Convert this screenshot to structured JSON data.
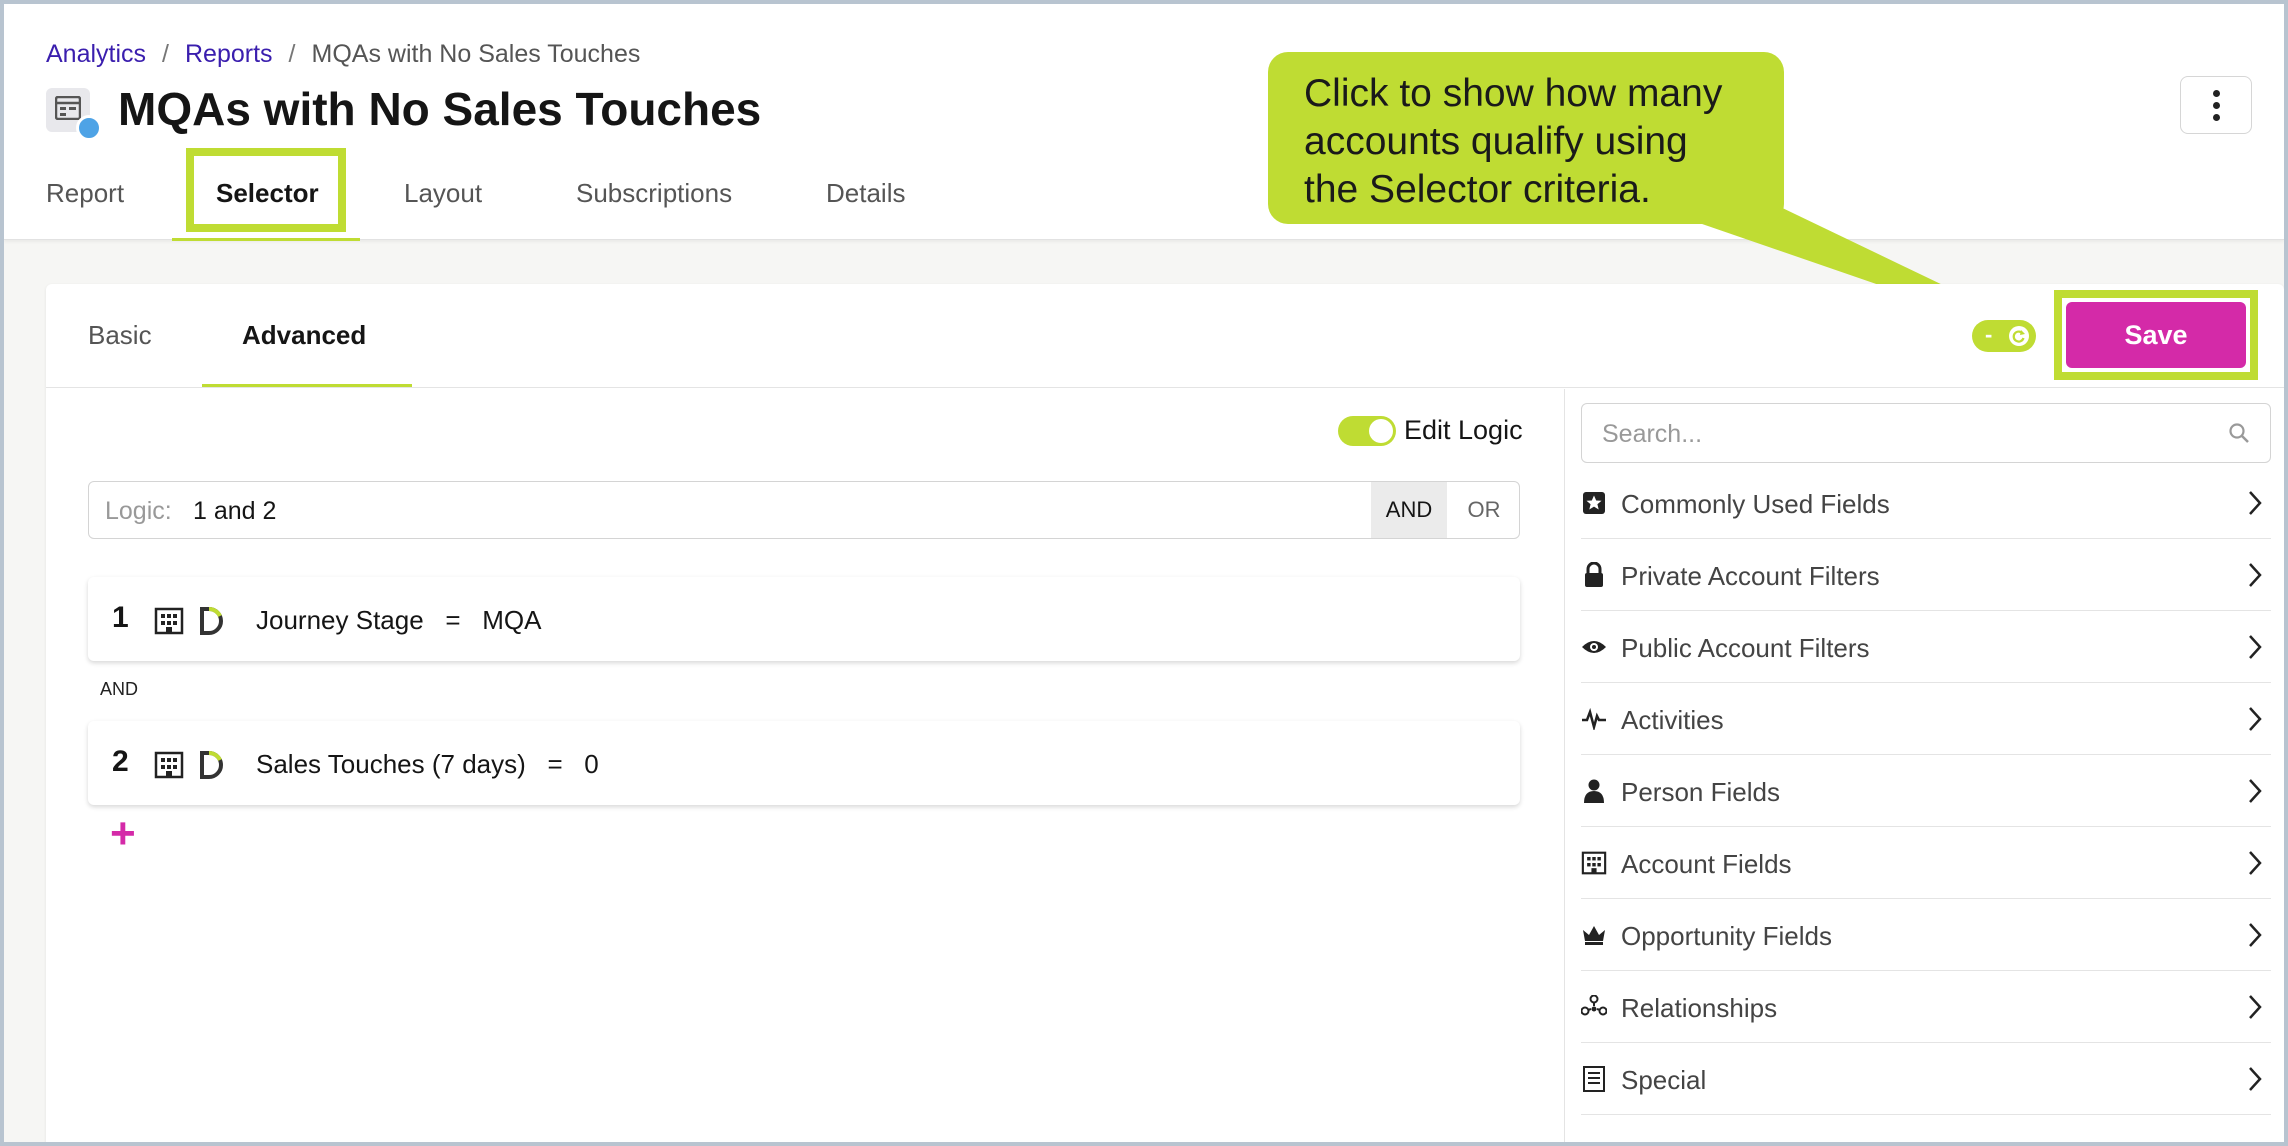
{
  "breadcrumb": {
    "items": [
      "Analytics",
      "Reports"
    ],
    "current": "MQAs with No Sales Touches",
    "separator": "/"
  },
  "page": {
    "title": "MQAs with No Sales Touches"
  },
  "tabs": {
    "report": "Report",
    "selector": "Selector",
    "layout": "Layout",
    "subscriptions": "Subscriptions",
    "details": "Details",
    "active": "Selector"
  },
  "callout": {
    "text": "Click to show how many accounts qualify using the Selector criteria."
  },
  "selector": {
    "subtabs": {
      "basic": "Basic",
      "advanced": "Advanced",
      "active": "Advanced"
    },
    "count_toggle_text": "-",
    "save_label": "Save",
    "edit_logic": {
      "label": "Edit Logic",
      "enabled": true
    },
    "logic": {
      "label": "Logic:",
      "value": "1 and 2",
      "and_label": "AND",
      "or_label": "OR"
    },
    "conditions": [
      {
        "number": "1",
        "text": "Journey Stage   =   MQA"
      },
      {
        "number": "2",
        "text": "Sales Touches (7 days)   =   0"
      }
    ],
    "conjunction": "AND",
    "add_label": "+"
  },
  "field_panel": {
    "search_placeholder": "Search...",
    "categories": [
      {
        "label": "Commonly Used Fields",
        "icon": "star-icon"
      },
      {
        "label": "Private Account Filters",
        "icon": "lock-icon"
      },
      {
        "label": "Public Account Filters",
        "icon": "eye-icon"
      },
      {
        "label": "Activities",
        "icon": "pulse-icon"
      },
      {
        "label": "Person Fields",
        "icon": "person-icon"
      },
      {
        "label": "Account Fields",
        "icon": "building-icon"
      },
      {
        "label": "Opportunity Fields",
        "icon": "crown-icon"
      },
      {
        "label": "Relationships",
        "icon": "network-icon"
      },
      {
        "label": "Special",
        "icon": "list-icon"
      }
    ]
  },
  "colors": {
    "accent": "#bfdc33",
    "primary": "#d42aa8",
    "link": "#3a1eae"
  }
}
